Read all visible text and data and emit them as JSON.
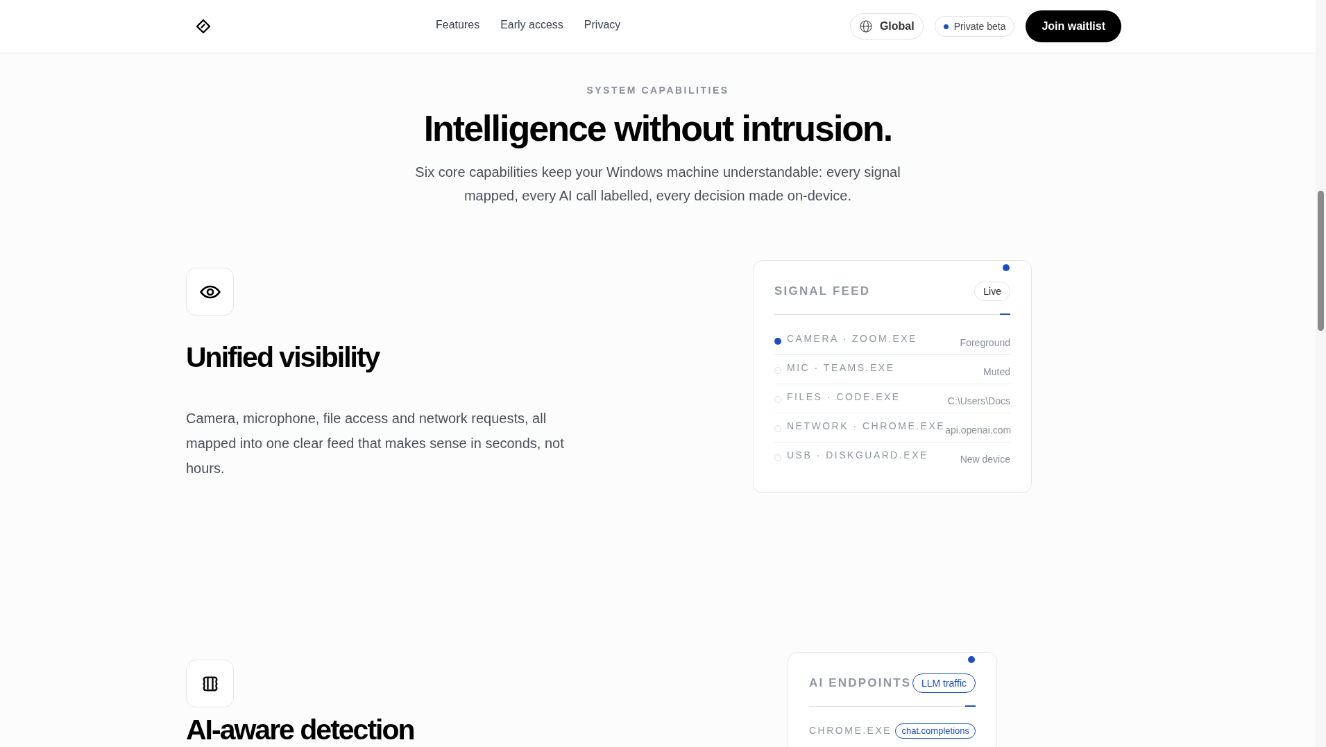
{
  "nav": {
    "links": [
      "Features",
      "Early access",
      "Privacy"
    ],
    "region": "Global",
    "beta": "Private beta",
    "cta": "Join waitlist"
  },
  "hero": {
    "eyebrow": "SYSTEM CAPABILITIES",
    "title": "Intelligence without intrusion.",
    "subtitle": "Six core capabilities keep your Windows machine understandable: every signal mapped, every AI call labelled, every decision made on-device."
  },
  "features": [
    {
      "title": "Unified visibility",
      "body": "Camera, microphone, file access and network requests, all mapped into one clear feed that makes sense in seconds, not hours.",
      "card": {
        "title": "SIGNAL FEED",
        "badge": {
          "text": "Live",
          "highlighted": false
        },
        "rows": [
          {
            "label": "CAMERA · ZOOM.EXE",
            "detail": "Foreground",
            "active": true
          },
          {
            "label": "MIC · TEAMS.EXE",
            "detail": "Muted",
            "active": false
          },
          {
            "label": "FILES · CODE.EXE",
            "detail": "C:\\Users\\Docs",
            "active": false
          },
          {
            "label": "NETWORK · CHROME.EXE",
            "detail": "api.openai.com",
            "active": false
          },
          {
            "label": "USB · DISKGUARD.EXE",
            "detail": "New device",
            "active": false
          }
        ]
      }
    },
    {
      "title": "AI-aware detection",
      "card": {
        "title": "AI ENDPOINTS",
        "badge": {
          "text": "LLM traffic",
          "highlighted": true
        },
        "rows": [
          {
            "label": "CHROME.EXE",
            "tag": "chat.completions"
          }
        ]
      }
    }
  ]
}
